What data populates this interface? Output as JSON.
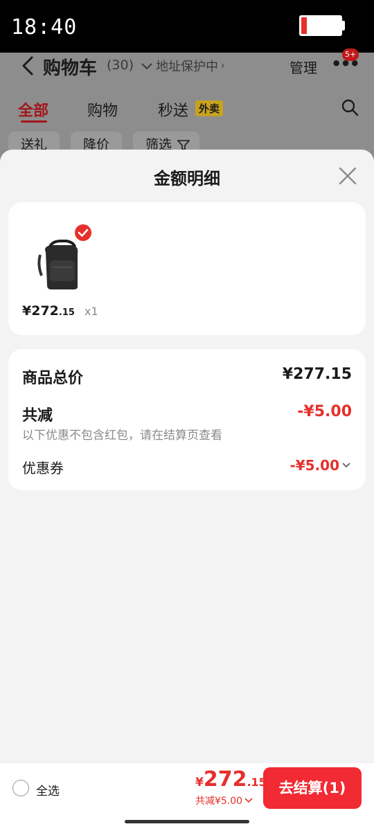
{
  "status_bar": {
    "time": "18:40"
  },
  "cart_header": {
    "title": "购物车",
    "count": "(30)",
    "address_protection": "地址保护中",
    "manage": "管理",
    "badge": "5+"
  },
  "tabs": [
    {
      "label": "全部",
      "active": true
    },
    {
      "label": "购物"
    },
    {
      "label": "秒送",
      "tag": "外卖"
    }
  ],
  "filter_chips": [
    "送礼",
    "降价",
    "筛选"
  ],
  "sheet": {
    "title": "金额明细",
    "product": {
      "price_symbol": "¥",
      "price_int": "272",
      "price_dec": ".15",
      "quantity": "x1"
    },
    "summary": {
      "total_label": "商品总价",
      "total_value": "¥277.15",
      "discount_label": "共减",
      "discount_value": "-¥5.00",
      "discount_note": "以下优惠不包含红包，请在结算页查看",
      "coupon_label": "优惠券",
      "coupon_value": "-¥5.00"
    }
  },
  "bottom_bar": {
    "select_all": "全选",
    "currency": "¥",
    "total_int": "272",
    "total_dec": ".15",
    "saved": "共减¥5.00",
    "checkout": "去结算(1)"
  },
  "colors": {
    "accent_red": "#e5302b",
    "checkout_red": "#f12a33"
  }
}
